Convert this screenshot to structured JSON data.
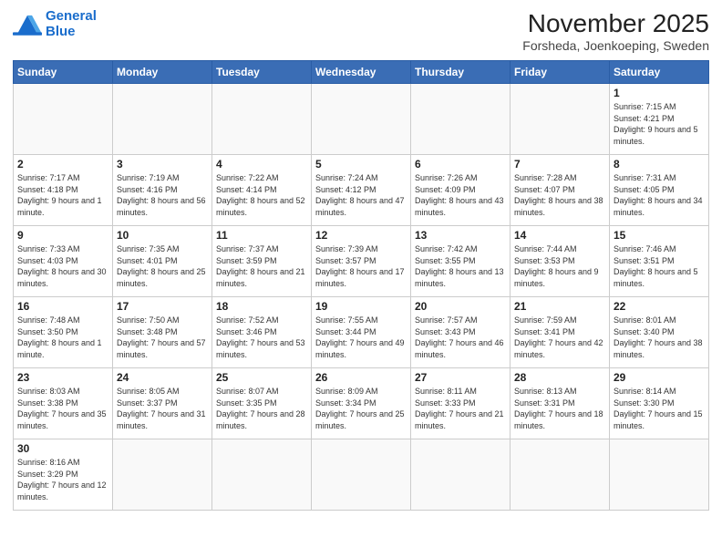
{
  "logo": {
    "line1": "General",
    "line2": "Blue"
  },
  "title": "November 2025",
  "subtitle": "Forsheda, Joenkoeping, Sweden",
  "weekdays": [
    "Sunday",
    "Monday",
    "Tuesday",
    "Wednesday",
    "Thursday",
    "Friday",
    "Saturday"
  ],
  "weeks": [
    [
      {
        "day": "",
        "info": ""
      },
      {
        "day": "",
        "info": ""
      },
      {
        "day": "",
        "info": ""
      },
      {
        "day": "",
        "info": ""
      },
      {
        "day": "",
        "info": ""
      },
      {
        "day": "",
        "info": ""
      },
      {
        "day": "1",
        "info": "Sunrise: 7:15 AM\nSunset: 4:21 PM\nDaylight: 9 hours and 5 minutes."
      }
    ],
    [
      {
        "day": "2",
        "info": "Sunrise: 7:17 AM\nSunset: 4:18 PM\nDaylight: 9 hours and 1 minute."
      },
      {
        "day": "3",
        "info": "Sunrise: 7:19 AM\nSunset: 4:16 PM\nDaylight: 8 hours and 56 minutes."
      },
      {
        "day": "4",
        "info": "Sunrise: 7:22 AM\nSunset: 4:14 PM\nDaylight: 8 hours and 52 minutes."
      },
      {
        "day": "5",
        "info": "Sunrise: 7:24 AM\nSunset: 4:12 PM\nDaylight: 8 hours and 47 minutes."
      },
      {
        "day": "6",
        "info": "Sunrise: 7:26 AM\nSunset: 4:09 PM\nDaylight: 8 hours and 43 minutes."
      },
      {
        "day": "7",
        "info": "Sunrise: 7:28 AM\nSunset: 4:07 PM\nDaylight: 8 hours and 38 minutes."
      },
      {
        "day": "8",
        "info": "Sunrise: 7:31 AM\nSunset: 4:05 PM\nDaylight: 8 hours and 34 minutes."
      }
    ],
    [
      {
        "day": "9",
        "info": "Sunrise: 7:33 AM\nSunset: 4:03 PM\nDaylight: 8 hours and 30 minutes."
      },
      {
        "day": "10",
        "info": "Sunrise: 7:35 AM\nSunset: 4:01 PM\nDaylight: 8 hours and 25 minutes."
      },
      {
        "day": "11",
        "info": "Sunrise: 7:37 AM\nSunset: 3:59 PM\nDaylight: 8 hours and 21 minutes."
      },
      {
        "day": "12",
        "info": "Sunrise: 7:39 AM\nSunset: 3:57 PM\nDaylight: 8 hours and 17 minutes."
      },
      {
        "day": "13",
        "info": "Sunrise: 7:42 AM\nSunset: 3:55 PM\nDaylight: 8 hours and 13 minutes."
      },
      {
        "day": "14",
        "info": "Sunrise: 7:44 AM\nSunset: 3:53 PM\nDaylight: 8 hours and 9 minutes."
      },
      {
        "day": "15",
        "info": "Sunrise: 7:46 AM\nSunset: 3:51 PM\nDaylight: 8 hours and 5 minutes."
      }
    ],
    [
      {
        "day": "16",
        "info": "Sunrise: 7:48 AM\nSunset: 3:50 PM\nDaylight: 8 hours and 1 minute."
      },
      {
        "day": "17",
        "info": "Sunrise: 7:50 AM\nSunset: 3:48 PM\nDaylight: 7 hours and 57 minutes."
      },
      {
        "day": "18",
        "info": "Sunrise: 7:52 AM\nSunset: 3:46 PM\nDaylight: 7 hours and 53 minutes."
      },
      {
        "day": "19",
        "info": "Sunrise: 7:55 AM\nSunset: 3:44 PM\nDaylight: 7 hours and 49 minutes."
      },
      {
        "day": "20",
        "info": "Sunrise: 7:57 AM\nSunset: 3:43 PM\nDaylight: 7 hours and 46 minutes."
      },
      {
        "day": "21",
        "info": "Sunrise: 7:59 AM\nSunset: 3:41 PM\nDaylight: 7 hours and 42 minutes."
      },
      {
        "day": "22",
        "info": "Sunrise: 8:01 AM\nSunset: 3:40 PM\nDaylight: 7 hours and 38 minutes."
      }
    ],
    [
      {
        "day": "23",
        "info": "Sunrise: 8:03 AM\nSunset: 3:38 PM\nDaylight: 7 hours and 35 minutes."
      },
      {
        "day": "24",
        "info": "Sunrise: 8:05 AM\nSunset: 3:37 PM\nDaylight: 7 hours and 31 minutes."
      },
      {
        "day": "25",
        "info": "Sunrise: 8:07 AM\nSunset: 3:35 PM\nDaylight: 7 hours and 28 minutes."
      },
      {
        "day": "26",
        "info": "Sunrise: 8:09 AM\nSunset: 3:34 PM\nDaylight: 7 hours and 25 minutes."
      },
      {
        "day": "27",
        "info": "Sunrise: 8:11 AM\nSunset: 3:33 PM\nDaylight: 7 hours and 21 minutes."
      },
      {
        "day": "28",
        "info": "Sunrise: 8:13 AM\nSunset: 3:31 PM\nDaylight: 7 hours and 18 minutes."
      },
      {
        "day": "29",
        "info": "Sunrise: 8:14 AM\nSunset: 3:30 PM\nDaylight: 7 hours and 15 minutes."
      }
    ],
    [
      {
        "day": "30",
        "info": "Sunrise: 8:16 AM\nSunset: 3:29 PM\nDaylight: 7 hours and 12 minutes."
      },
      {
        "day": "",
        "info": ""
      },
      {
        "day": "",
        "info": ""
      },
      {
        "day": "",
        "info": ""
      },
      {
        "day": "",
        "info": ""
      },
      {
        "day": "",
        "info": ""
      },
      {
        "day": "",
        "info": ""
      }
    ]
  ]
}
